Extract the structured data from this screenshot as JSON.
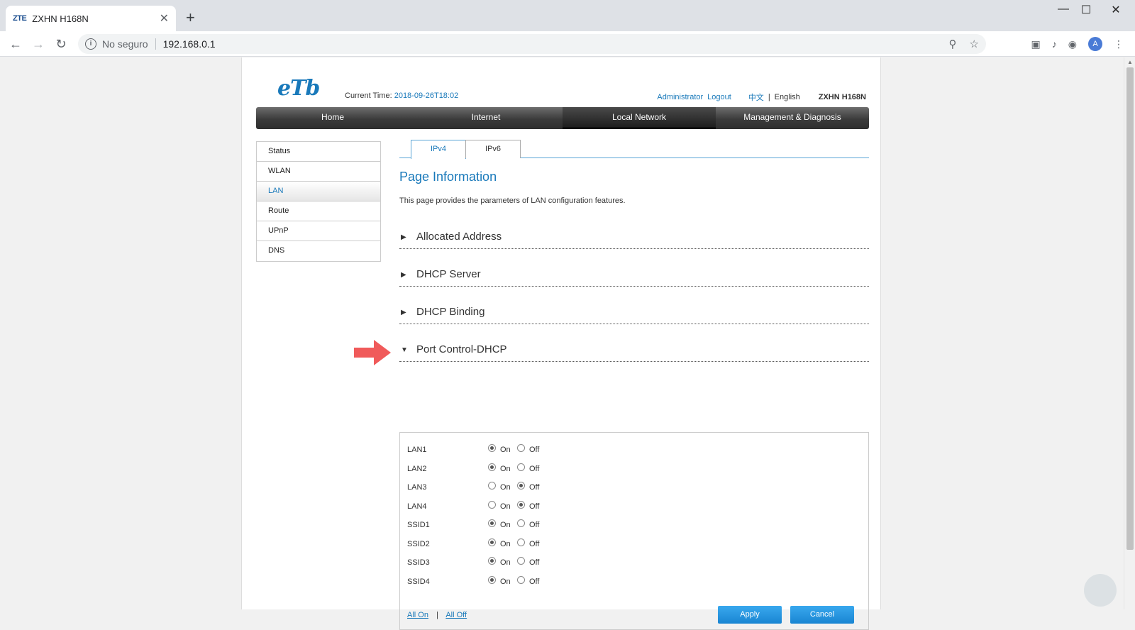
{
  "browser": {
    "tab_favicon": "ZTE",
    "tab_title": "ZXHN H168N",
    "close_glyph": "✕",
    "new_tab_glyph": "+",
    "security_label": "No seguro",
    "url": "192.168.0.1",
    "profile_initial": "A"
  },
  "header": {
    "logo": "eTb",
    "current_time_label": "Current Time:",
    "current_time_value": "2018-09-26T18:02",
    "user": "Administrator",
    "logout": "Logout",
    "lang_cn": "中文",
    "lang_sep": "|",
    "lang_en": "English",
    "model": "ZXHN H168N"
  },
  "main_nav": {
    "items": [
      "Home",
      "Internet",
      "Local Network",
      "Management & Diagnosis"
    ],
    "active_index": 2
  },
  "side_menu": {
    "items": [
      "Status",
      "WLAN",
      "LAN",
      "Route",
      "UPnP",
      "DNS"
    ],
    "active_index": 2
  },
  "content_tabs": {
    "items": [
      "IPv4",
      "IPv6"
    ],
    "active_index": 0
  },
  "page_info": {
    "title": "Page Information",
    "text": "This page provides the parameters of LAN configuration features."
  },
  "sections": [
    {
      "label": "Allocated Address",
      "expanded": false
    },
    {
      "label": "DHCP Server",
      "expanded": false
    },
    {
      "label": "DHCP Binding",
      "expanded": false
    },
    {
      "label": "Port Control-DHCP",
      "expanded": true
    }
  ],
  "port_control": {
    "on_label": "On",
    "off_label": "Off",
    "ports": [
      {
        "name": "LAN1",
        "state": "on"
      },
      {
        "name": "LAN2",
        "state": "on"
      },
      {
        "name": "LAN3",
        "state": "off"
      },
      {
        "name": "LAN4",
        "state": "off"
      },
      {
        "name": "SSID1",
        "state": "on"
      },
      {
        "name": "SSID2",
        "state": "on"
      },
      {
        "name": "SSID3",
        "state": "on"
      },
      {
        "name": "SSID4",
        "state": "on"
      }
    ],
    "all_on": "All On",
    "separator": "|",
    "all_off": "All Off",
    "apply": "Apply",
    "cancel": "Cancel"
  },
  "colors": {
    "accent": "#1979ba",
    "button": "#1985d2",
    "annotation_arrow": "#f05a5a"
  }
}
